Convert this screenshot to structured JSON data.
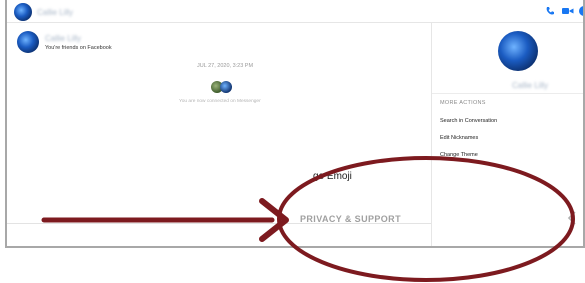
{
  "topbar": {
    "contact_name": "Callie Lilly"
  },
  "chat": {
    "friend_name": "Callie Lilly",
    "friend_status": "You're friends on Facebook",
    "date_stamp": "JUL 27, 2020, 3:23 PM",
    "connected_text": "You are now connected on Messenger"
  },
  "panel": {
    "contact_name": "Callie Lilly",
    "more_actions_label": "MORE ACTIONS",
    "actions": [
      {
        "label": "Search in Conversation",
        "icon": "search-icon"
      },
      {
        "label": "Edit Nicknames",
        "icon": "pencil-icon"
      },
      {
        "label": "Change Theme",
        "icon": "theme-icon"
      },
      {
        "label": "Change Emoji",
        "icon": "thumbs-up-icon"
      }
    ],
    "emoji_partial_label": "ge Emoji",
    "privacy_label": "PRIVACY & SUPPORT"
  },
  "colors": {
    "accent": "#1877f2",
    "annotation": "#7d1a1f"
  }
}
